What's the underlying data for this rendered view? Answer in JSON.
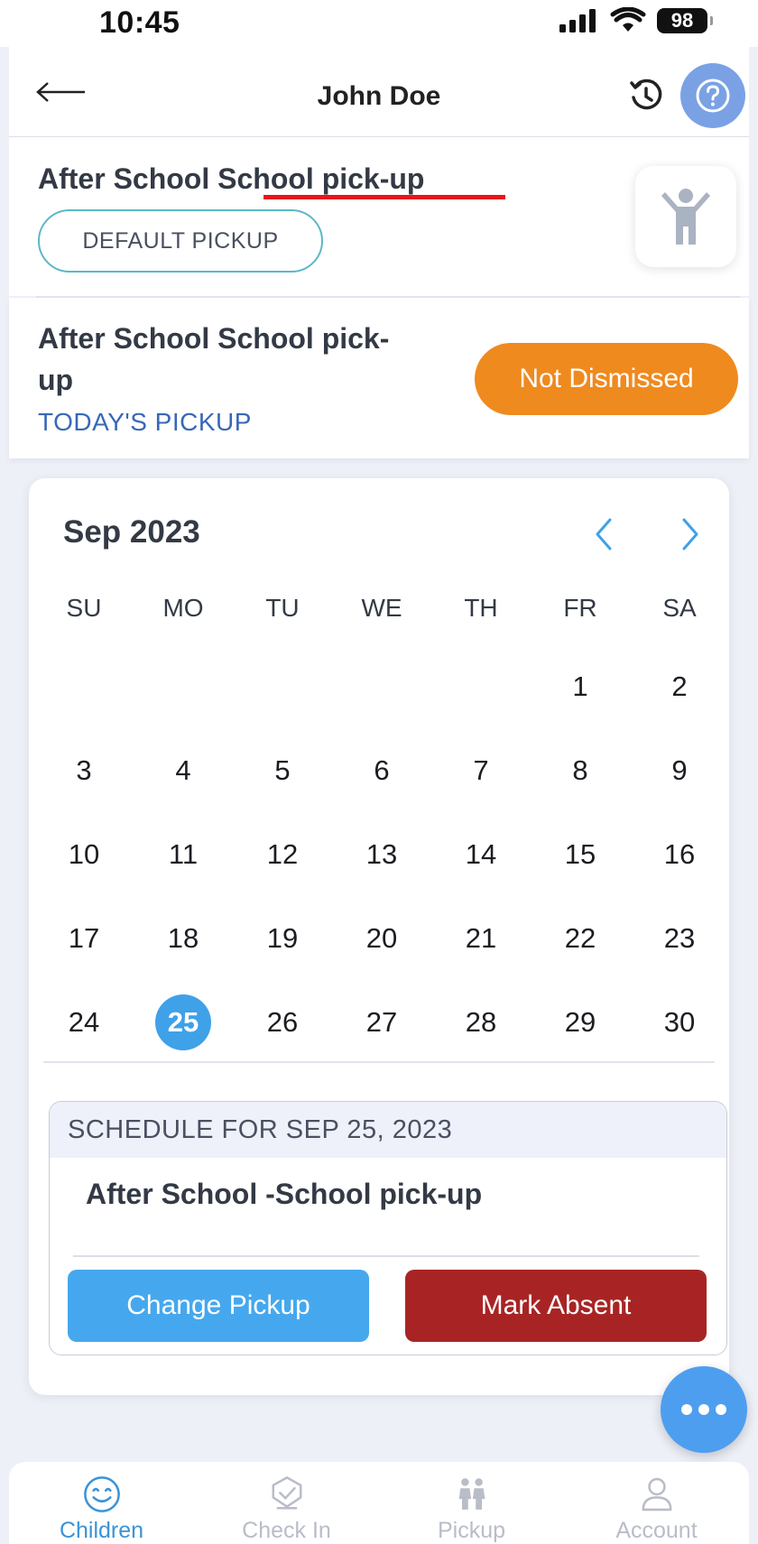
{
  "status_bar": {
    "time": "10:45",
    "battery": "98"
  },
  "header": {
    "title": "John Doe"
  },
  "default_pickup": {
    "title": "After School School pick-up",
    "tag": "DEFAULT PICKUP"
  },
  "today_pickup": {
    "title": "After School School pick-up",
    "label": "TODAY'S PICKUP",
    "status": "Not Dismissed"
  },
  "colors": {
    "accent_blue": "#3fa1e8",
    "status_orange": "#ef8a1e",
    "absent_red": "#a82424",
    "help_blue": "#7aa1e4"
  },
  "calendar": {
    "month_label": "Sep 2023",
    "weekdays": [
      "SU",
      "MO",
      "TU",
      "WE",
      "TH",
      "FR",
      "SA"
    ],
    "weeks": [
      [
        "",
        "",
        "",
        "",
        "",
        "1",
        "2"
      ],
      [
        "3",
        "4",
        "5",
        "6",
        "7",
        "8",
        "9"
      ],
      [
        "10",
        "11",
        "12",
        "13",
        "14",
        "15",
        "16"
      ],
      [
        "17",
        "18",
        "19",
        "20",
        "21",
        "22",
        "23"
      ],
      [
        "24",
        "25",
        "26",
        "27",
        "28",
        "29",
        "30"
      ]
    ],
    "selected_day": "25"
  },
  "schedule": {
    "header": "SCHEDULE FOR SEP 25, 2023",
    "item": "After School -School pick-up",
    "change_label": "Change Pickup",
    "absent_label": "Mark Absent"
  },
  "tabs": [
    {
      "label": "Children",
      "icon": "smiley-icon",
      "active": true
    },
    {
      "label": "Check In",
      "icon": "check-badge-icon",
      "active": false
    },
    {
      "label": "Pickup",
      "icon": "people-icon",
      "active": false
    },
    {
      "label": "Account",
      "icon": "user-icon",
      "active": false
    }
  ]
}
